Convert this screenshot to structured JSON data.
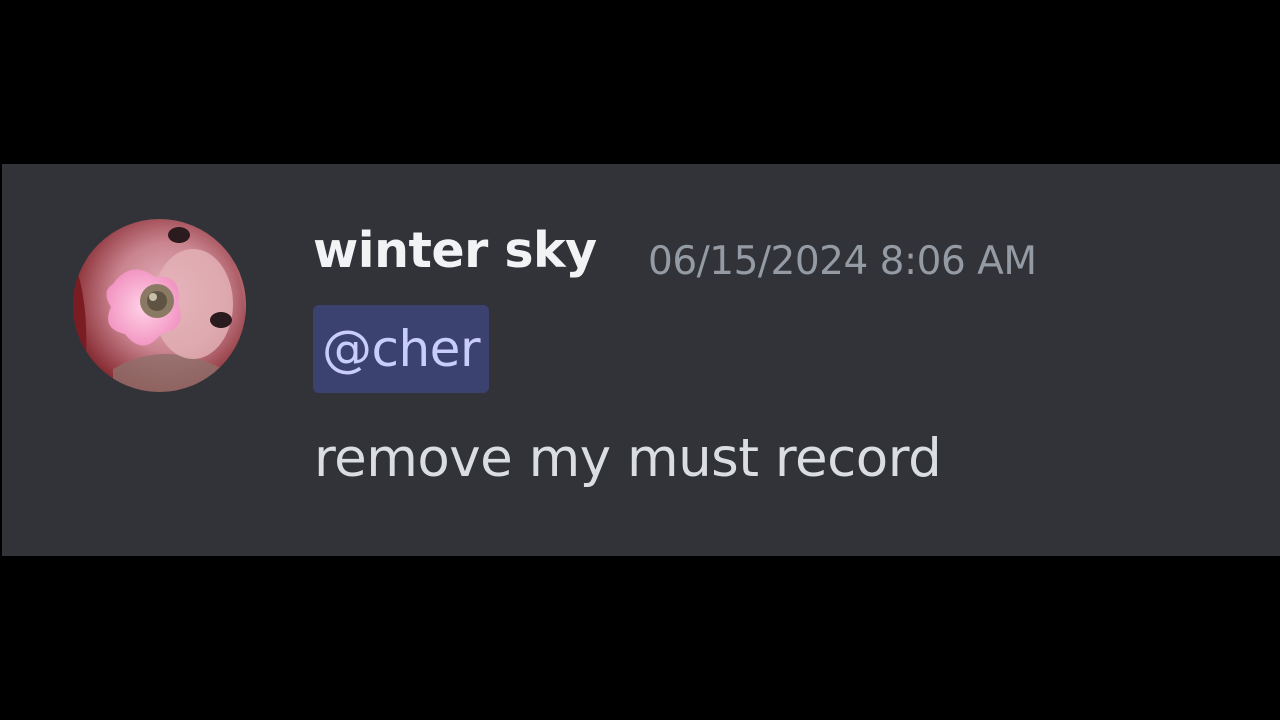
{
  "message": {
    "author": "winter sky",
    "timestamp": "06/15/2024 8:06 AM",
    "mention": "@cher",
    "content": "remove my must record"
  },
  "icons": {
    "avatar": "user-avatar-image"
  },
  "colors": {
    "page_background": "#000000",
    "message_background": "#313338",
    "username": "#f2f3f5",
    "timestamp": "#949ba4",
    "mention_background": "#3c4270",
    "mention_text": "#c9cdfb",
    "message_text": "#dbdee1"
  }
}
